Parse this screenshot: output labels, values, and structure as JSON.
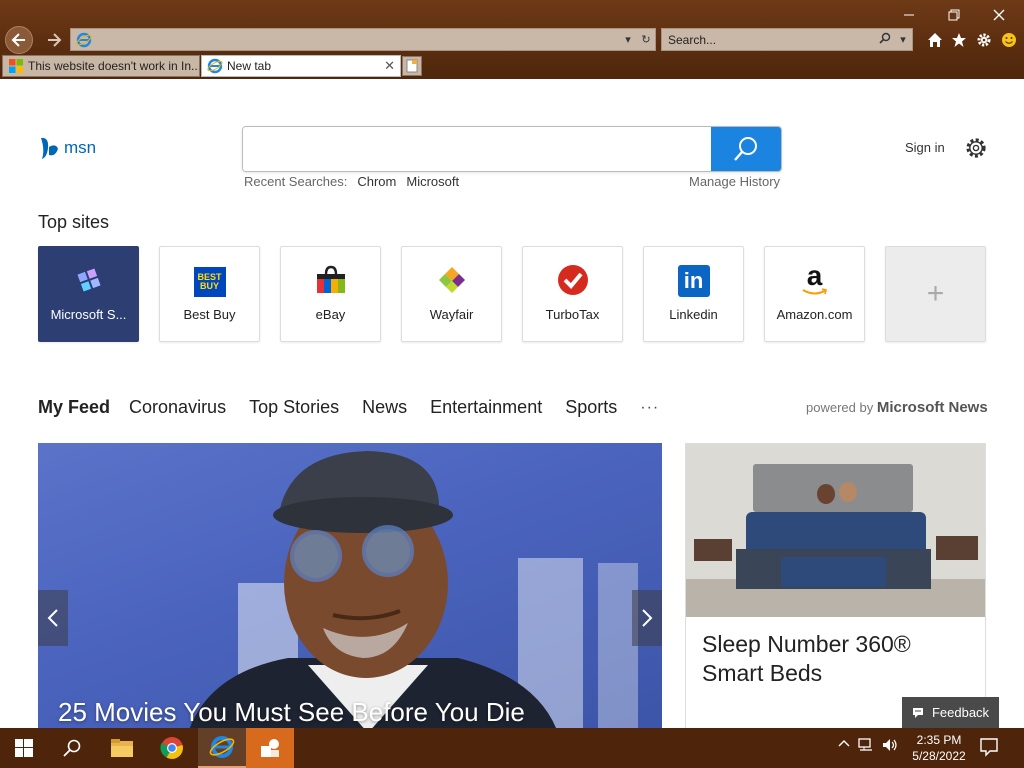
{
  "window": {
    "minimize_icon": "minimize-icon",
    "maximize_icon": "restore-icon",
    "close_icon": "close-icon"
  },
  "toolbar": {
    "address_value": "",
    "search_placeholder": "Search...",
    "icons": [
      "back-arrow-icon",
      "forward-arrow-icon",
      "refresh-icon",
      "home-icon",
      "star-icon",
      "gear-icon",
      "smiley-icon"
    ]
  },
  "tabs": [
    {
      "label": "This website doesn't work in In...",
      "active": false
    },
    {
      "label": "New tab",
      "active": true
    }
  ],
  "msn": {
    "logo_text": "msn",
    "search_value": "",
    "recent_label": "Recent Searches:",
    "recent_items": [
      "Chrom",
      "Microsoft"
    ],
    "manage_history": "Manage History",
    "sign_in": "Sign in"
  },
  "top_sites": {
    "title": "Top sites",
    "items": [
      {
        "label": "Microsoft S...",
        "icon": "microsoft-store-icon"
      },
      {
        "label": "Best Buy",
        "icon": "best-buy-logo-icon",
        "logo_text": "BEST BUY"
      },
      {
        "label": "eBay",
        "icon": "ebay-bag-icon"
      },
      {
        "label": "Wayfair",
        "icon": "wayfair-logo-icon"
      },
      {
        "label": "TurboTax",
        "icon": "turbotax-check-icon"
      },
      {
        "label": "Linkedin",
        "icon": "linkedin-logo-icon",
        "logo_text": "in"
      },
      {
        "label": "Amazon.com",
        "icon": "amazon-logo-icon",
        "logo_text": "a"
      },
      {
        "label": "+",
        "icon": "add-site-icon"
      }
    ]
  },
  "feed": {
    "tabs": [
      "My Feed",
      "Coronavirus",
      "Top Stories",
      "News",
      "Entertainment",
      "Sports"
    ],
    "more": "···",
    "powered_prefix": "powered by",
    "powered_brand": "Microsoft News",
    "hero_title": "25 Movies You Must See Before You Die",
    "ad_title": "Sleep Number 360® Smart Beds",
    "feedback": "Feedback"
  },
  "taskbar": {
    "time": "2:35 PM",
    "date": "5/28/2022",
    "apps": [
      "windows-start-icon",
      "search-icon",
      "file-explorer-icon",
      "chrome-icon",
      "internet-explorer-icon",
      "app-icon"
    ]
  },
  "colors": {
    "chrome_brown": "#5a2d0f",
    "msn_blue": "#0067b8",
    "search_blue": "#1a84e0",
    "taskbar": "#4e250a"
  }
}
